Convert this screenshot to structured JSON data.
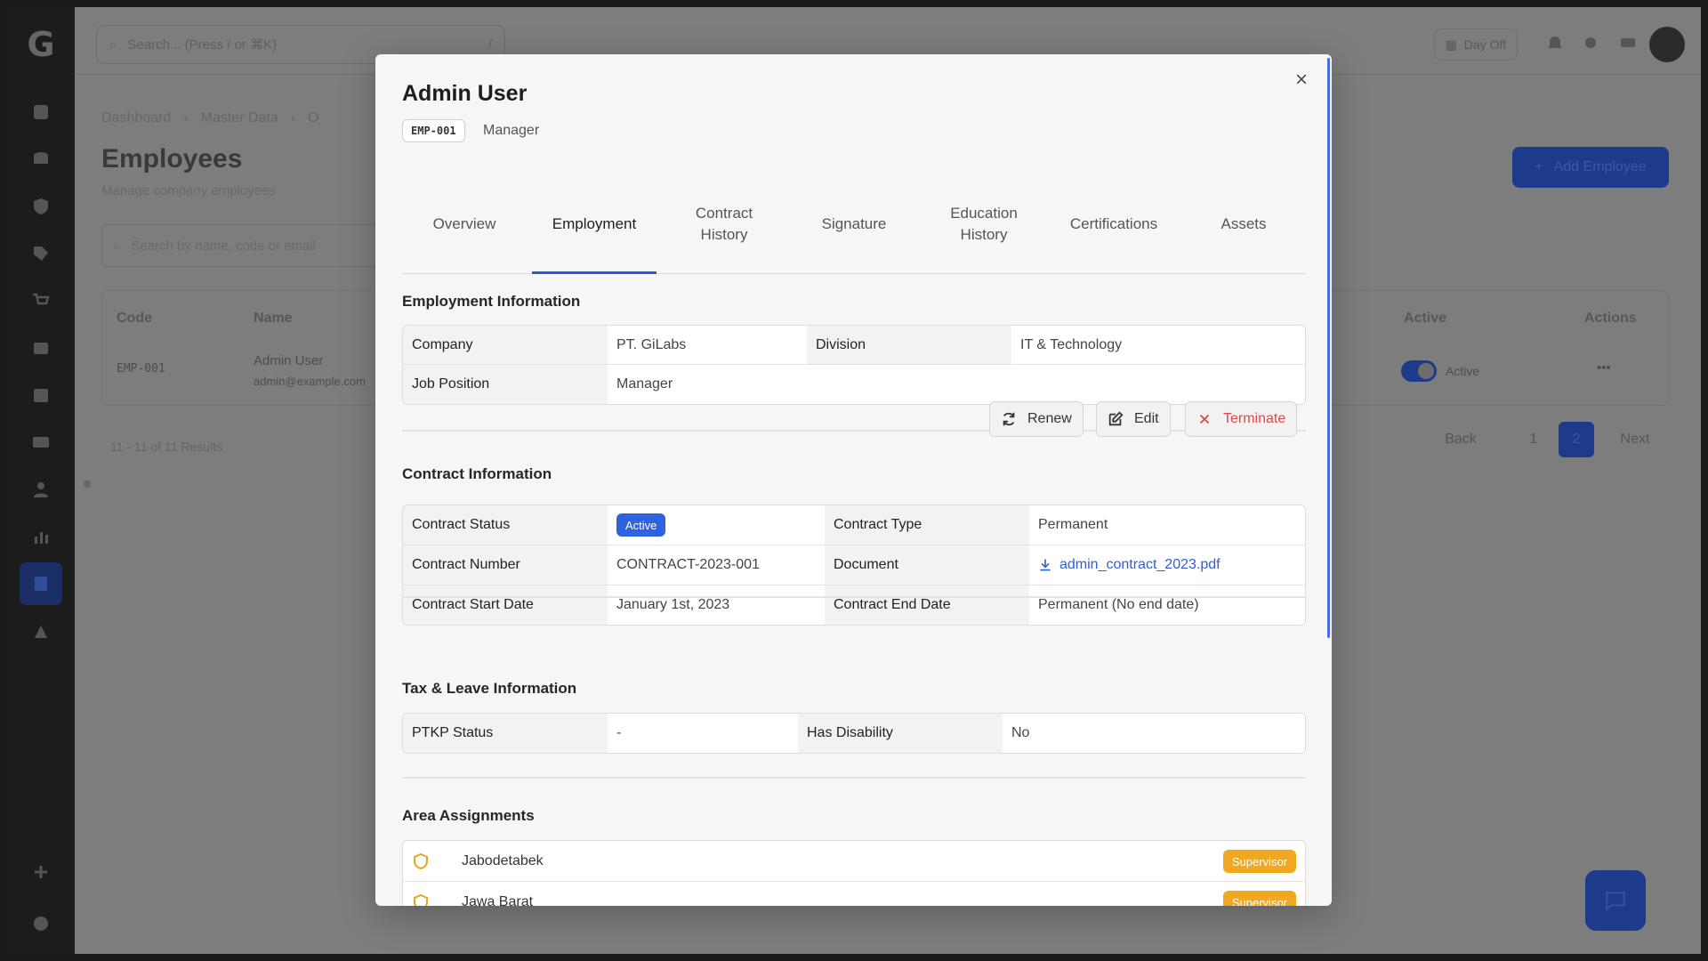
{
  "background": {
    "search_placeholder": "Search... (Press / or ⌘K)",
    "search_kbd": "/",
    "day_off_label": "Day Off",
    "breadcrumb": [
      "Dashboard",
      "Master Data",
      "O"
    ],
    "page_title": "Employees",
    "page_subtitle": "Manage company employees",
    "list_search_placeholder": "Search by name, code or email",
    "add_button": "Add Employee",
    "table_headers": {
      "code": "Code",
      "name": "Name",
      "active": "Active",
      "actions": "Actions"
    },
    "row": {
      "code": "EMP-001",
      "name": "Admin User",
      "email": "admin@example.com",
      "status": "Active",
      "actions": "•••"
    },
    "results": "11 - 11 of 11 Results",
    "pager": {
      "back": "Back",
      "page1": "1",
      "page2": "2",
      "next": "Next"
    }
  },
  "modal": {
    "title": "Admin User",
    "employee_code": "EMP-001",
    "role": "Manager",
    "close_icon": "close-icon",
    "tabs": [
      {
        "label": "Overview"
      },
      {
        "label": "Employment"
      },
      {
        "label": "Contract\nHistory"
      },
      {
        "label": "Signature"
      },
      {
        "label": "Education\nHistory"
      },
      {
        "label": "Certifications"
      },
      {
        "label": "Assets"
      }
    ],
    "active_tab": "Employment",
    "employment": {
      "title": "Employment Information",
      "company_label": "Company",
      "company_value": "PT. GiLabs",
      "division_label": "Division",
      "division_value": "IT & Technology",
      "job_label": "Job Position",
      "job_value": "Manager"
    },
    "contract": {
      "title": "Contract Information",
      "renew_label": "Renew",
      "edit_label": "Edit",
      "terminate_label": "Terminate",
      "status_label": "Contract Status",
      "status_value": "Active",
      "type_label": "Contract Type",
      "type_value": "Permanent",
      "number_label": "Contract Number",
      "number_value": "CONTRACT-2023-001",
      "document_label": "Document",
      "document_value": "admin_contract_2023.pdf",
      "start_label": "Contract Start Date",
      "start_value": "January 1st, 2023",
      "end_label": "Contract End Date",
      "end_value": "Permanent (No end date)"
    },
    "tax": {
      "title": "Tax & Leave Information",
      "ptkp_label": "PTKP Status",
      "ptkp_value": "-",
      "disability_label": "Has Disability",
      "disability_value": "No"
    },
    "areas": {
      "title": "Area Assignments",
      "items": [
        {
          "name": "Jabodetabek",
          "role": "Supervisor"
        },
        {
          "name": "Jawa Barat",
          "role": "Supervisor"
        }
      ]
    }
  },
  "colors": {
    "accent": "#2a5bd7",
    "active_badge": "#2e62e0",
    "supervisor_badge": "#f2a81e",
    "danger": "#e04848",
    "overlay": "#7d7d7d"
  }
}
